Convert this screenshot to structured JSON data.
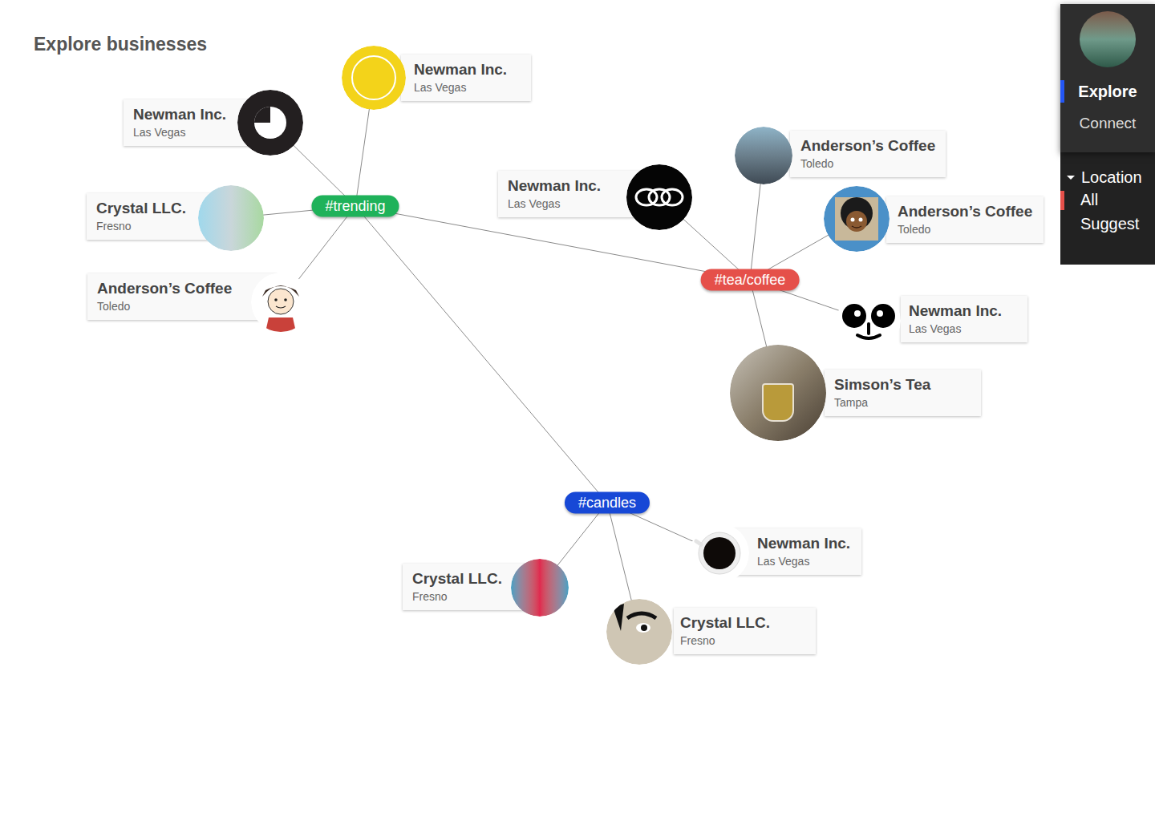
{
  "page": {
    "title": "Explore businesses"
  },
  "nav": {
    "items": [
      {
        "label": "Explore",
        "selected": true
      },
      {
        "label": "Connect",
        "selected": false
      }
    ]
  },
  "filter": {
    "label": "Location",
    "expanded": true,
    "options": [
      {
        "label": "All",
        "selected": true
      },
      {
        "label": "Suggest",
        "selected": false
      }
    ]
  },
  "tags": [
    {
      "label": "#trending",
      "color": "#1fb25a",
      "links": [
        "#tea/coffee",
        "#candles"
      ]
    },
    {
      "label": "#tea/coffee",
      "color": "#e5504a",
      "links": []
    },
    {
      "label": "#candles",
      "color": "#1748d6",
      "links": []
    }
  ],
  "businesses": [
    {
      "name": "Newman Inc.",
      "city": "Las Vegas",
      "tag": "#trending"
    },
    {
      "name": "Newman Inc.",
      "city": "Las Vegas",
      "tag": "#trending"
    },
    {
      "name": "Crystal LLC.",
      "city": "Fresno",
      "tag": "#trending"
    },
    {
      "name": "Anderson’s Coffee",
      "city": "Toledo",
      "tag": "#trending"
    },
    {
      "name": "Newman Inc.",
      "city": "Las Vegas",
      "tag": "#tea/coffee"
    },
    {
      "name": "Anderson’s Coffee",
      "city": "Toledo",
      "tag": "#tea/coffee"
    },
    {
      "name": "Anderson’s Coffee",
      "city": "Toledo",
      "tag": "#tea/coffee"
    },
    {
      "name": "Newman Inc.",
      "city": "Las Vegas",
      "tag": "#tea/coffee"
    },
    {
      "name": "Simson’s Tea",
      "city": "Tampa",
      "tag": "#tea/coffee"
    },
    {
      "name": "Newman Inc.",
      "city": "Las Vegas",
      "tag": "#candles"
    },
    {
      "name": "Crystal LLC.",
      "city": "Fresno",
      "tag": "#candles"
    },
    {
      "name": "Crystal LLC.",
      "city": "Fresno",
      "tag": "#candles"
    }
  ]
}
